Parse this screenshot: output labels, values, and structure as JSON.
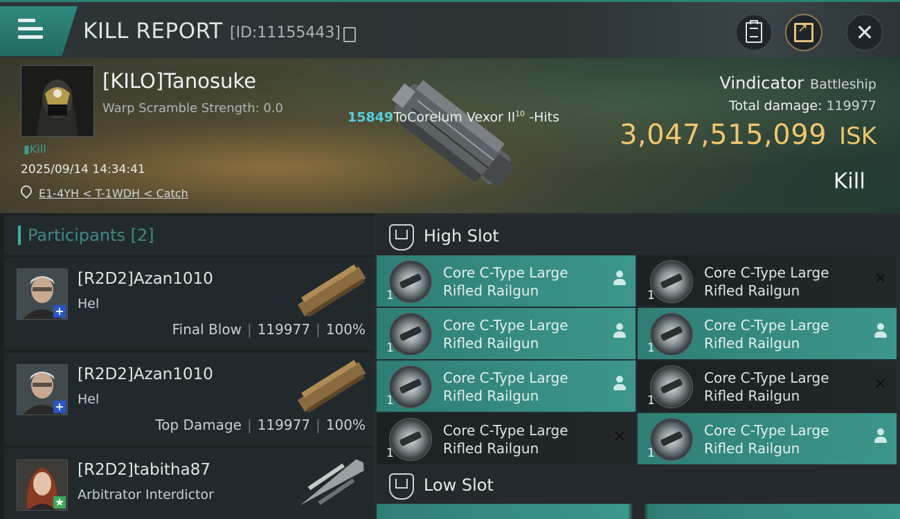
{
  "header": {
    "title": "KILL REPORT",
    "id_text": "[ID:11155443]"
  },
  "victim": {
    "name": "[KILO]Tanosuke",
    "warp_scramble": "Warp Scramble Strength: 0.0",
    "kill_tag": "Kill",
    "date": "2025/09/14 14:34:41",
    "location": "E1-4YH < T-1WDH < Catch",
    "ship_name": "Vindicator",
    "ship_class": "Battleship",
    "total_damage_label": "Total damage:",
    "total_damage": "119977",
    "isk_value": "3,047,515,099",
    "isk_unit": "ISK",
    "result": "Kill",
    "hits_number": "15849",
    "hits_text": "ToCorelum Vexor II",
    "hits_sup": "10",
    "hits_suffix": " -Hits"
  },
  "participants": {
    "header": "Participants [2]",
    "items": [
      {
        "name": "[R2D2]Azan1010",
        "ship": "Hel",
        "role": "Final Blow",
        "damage": "119977",
        "percent": "100%",
        "badge": "+"
      },
      {
        "name": "[R2D2]Azan1010",
        "ship": "Hel",
        "role": "Top Damage",
        "damage": "119977",
        "percent": "100%",
        "badge": "+"
      },
      {
        "name": "[R2D2]tabitha87",
        "ship": "Arbitrator Interdictor",
        "role": "",
        "damage": "",
        "percent": "",
        "badge": "★"
      }
    ]
  },
  "slots": {
    "high_label": "High Slot",
    "low_label": "Low Slot",
    "high_items": [
      {
        "line1": "Core C-Type Large",
        "line2": "Rifled Railgun",
        "qty": "1",
        "state": "person"
      },
      {
        "line1": "Core C-Type Large",
        "line2": "Rifled Railgun",
        "qty": "1",
        "state": "x"
      },
      {
        "line1": "Core C-Type Large",
        "line2": "Rifled Railgun",
        "qty": "1",
        "state": "person"
      },
      {
        "line1": "Core C-Type Large",
        "line2": "Rifled Railgun",
        "qty": "1",
        "state": "person"
      },
      {
        "line1": "Core C-Type Large",
        "line2": "Rifled Railgun",
        "qty": "1",
        "state": "person"
      },
      {
        "line1": "Core C-Type Large",
        "line2": "Rifled Railgun",
        "qty": "1",
        "state": "x"
      },
      {
        "line1": "Core C-Type Large",
        "line2": "Rifled Railgun",
        "qty": "1",
        "state": "x"
      },
      {
        "line1": "Core C-Type Large",
        "line2": "Rifled Railgun",
        "qty": "1",
        "state": "person"
      }
    ]
  },
  "icons": {
    "menu": "hamburger-icon",
    "copy": "copy-icon",
    "clipboard": "clipboard-icon",
    "share": "share-icon",
    "close": "close-icon",
    "location": "location-pin-icon",
    "slot": "slot-shield-icon",
    "person": "person-icon"
  },
  "colors": {
    "accent_teal": "#3c978b",
    "isk_gold": "#f2c56c",
    "hits_cyan": "#55d0e0"
  }
}
